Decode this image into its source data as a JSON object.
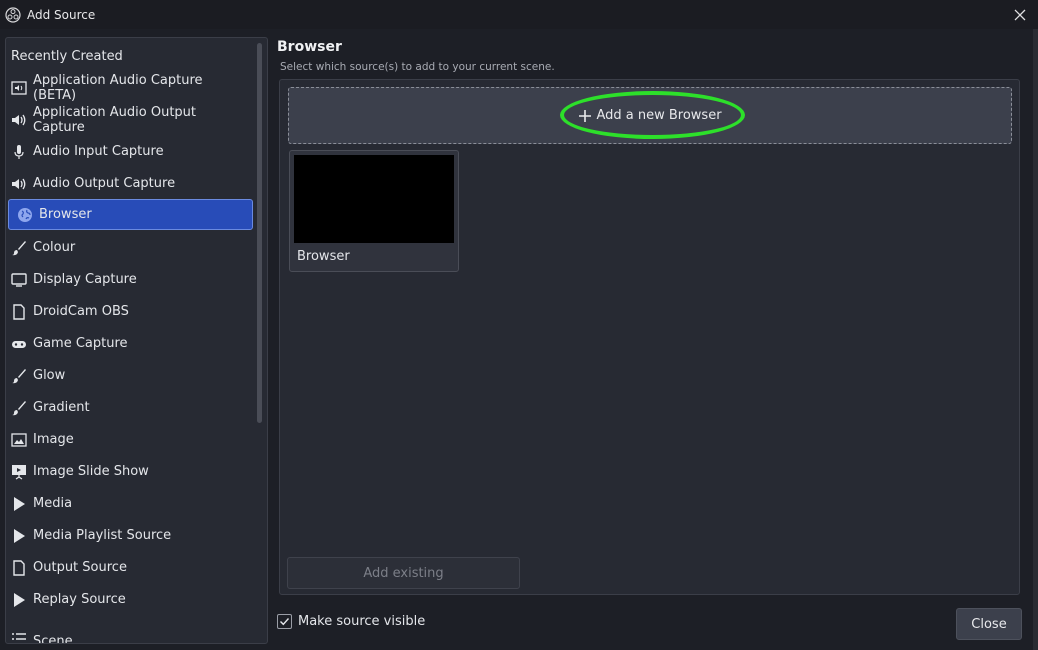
{
  "window": {
    "title": "Add Source"
  },
  "sidebar": {
    "header": "Recently Created",
    "items": [
      {
        "label": "Application Audio Capture (BETA)",
        "icon": "app-audio-capture-icon"
      },
      {
        "label": "Application Audio Output Capture",
        "icon": "speaker-icon"
      },
      {
        "label": "Audio Input Capture",
        "icon": "microphone-icon"
      },
      {
        "label": "Audio Output Capture",
        "icon": "speaker-icon"
      },
      {
        "label": "Browser",
        "icon": "globe-icon",
        "selected": true
      },
      {
        "label": "Colour",
        "icon": "brush-icon"
      },
      {
        "label": "Display Capture",
        "icon": "monitor-icon"
      },
      {
        "label": "DroidCam OBS",
        "icon": "file-icon"
      },
      {
        "label": "Game Capture",
        "icon": "gamepad-icon"
      },
      {
        "label": "Glow",
        "icon": "brush-icon"
      },
      {
        "label": "Gradient",
        "icon": "brush-icon"
      },
      {
        "label": "Image",
        "icon": "image-icon"
      },
      {
        "label": "Image Slide Show",
        "icon": "slideshow-icon"
      },
      {
        "label": "Media",
        "icon": "play-icon"
      },
      {
        "label": "Media Playlist Source",
        "icon": "play-icon"
      },
      {
        "label": "Output Source",
        "icon": "file-icon"
      },
      {
        "label": "Replay Source",
        "icon": "play-icon"
      },
      {
        "label": "Scene",
        "icon": "list-icon"
      }
    ]
  },
  "panel": {
    "title": "Browser",
    "subtitle": "Select which source(s) to add to your current scene.",
    "add_new_label": "Add a new Browser",
    "existing": [
      {
        "label": "Browser"
      }
    ],
    "add_existing_label": "Add existing"
  },
  "footer": {
    "make_visible_label": "Make source visible",
    "make_visible_checked": true,
    "close_label": "Close"
  },
  "colors": {
    "background": "#1d1f26",
    "selected": "#284cb8",
    "highlight": "#2de02a"
  }
}
